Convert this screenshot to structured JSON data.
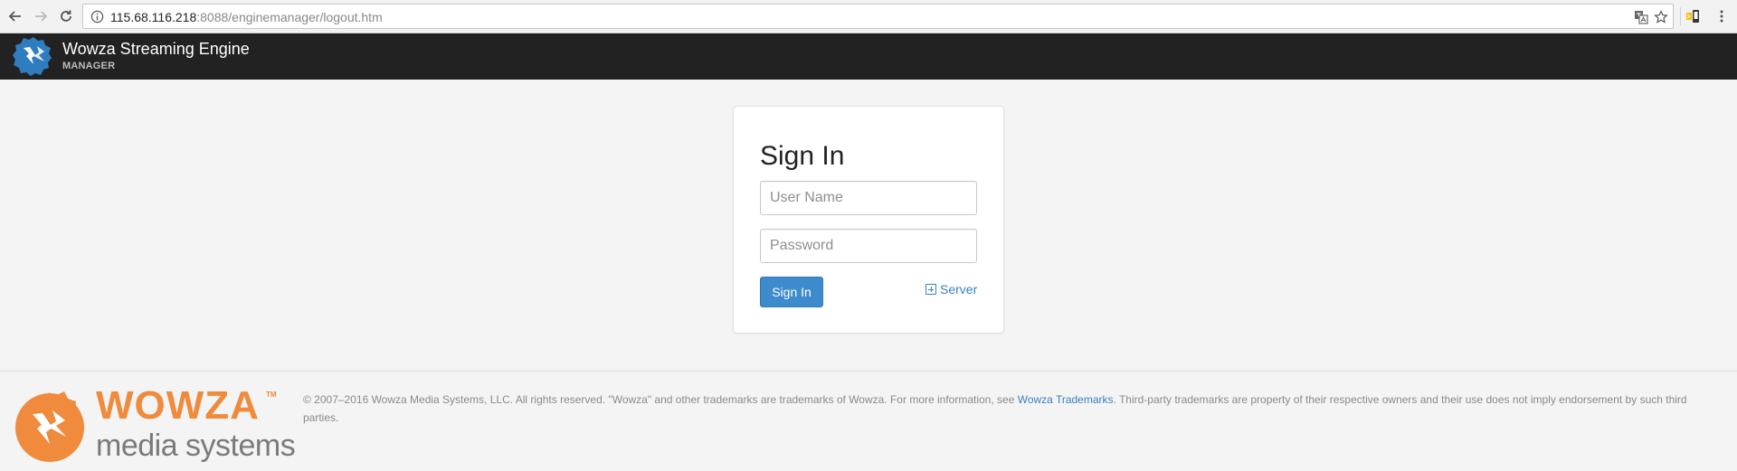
{
  "browser": {
    "url_host": "115.68.116.218",
    "url_path": ":8088/enginemanager/logout.htm"
  },
  "header": {
    "title": "Wowza Streaming Engine",
    "subtitle": "MANAGER"
  },
  "signin": {
    "heading": "Sign In",
    "username_placeholder": "User Name",
    "password_placeholder": "Password",
    "submit_label": "Sign In",
    "server_link_label": "Server"
  },
  "footer": {
    "brand_name": "WOWZA",
    "brand_tm": "TM",
    "brand_sub": "media systems",
    "copyright_before": "© 2007–2016 Wowza Media Systems, LLC. All rights reserved. \"Wowza\" and other trademarks are trademarks of Wowza. For more information, see ",
    "trademarks_link": "Wowza Trademarks",
    "copyright_after": ". Third-party trademarks are property of their respective owners and their use does not imply endorsement by such third parties."
  },
  "colors": {
    "header_bg": "#222222",
    "button_blue": "#3d8bcc",
    "link_blue": "#3a7fc0",
    "brand_orange": "#f08a3c"
  },
  "icons": [
    "back-arrow-icon",
    "forward-arrow-icon",
    "reload-icon",
    "info-icon",
    "translate-icon",
    "bookmark-star-icon",
    "extension-icon",
    "wowza-logo-icon",
    "plus-square-icon"
  ]
}
